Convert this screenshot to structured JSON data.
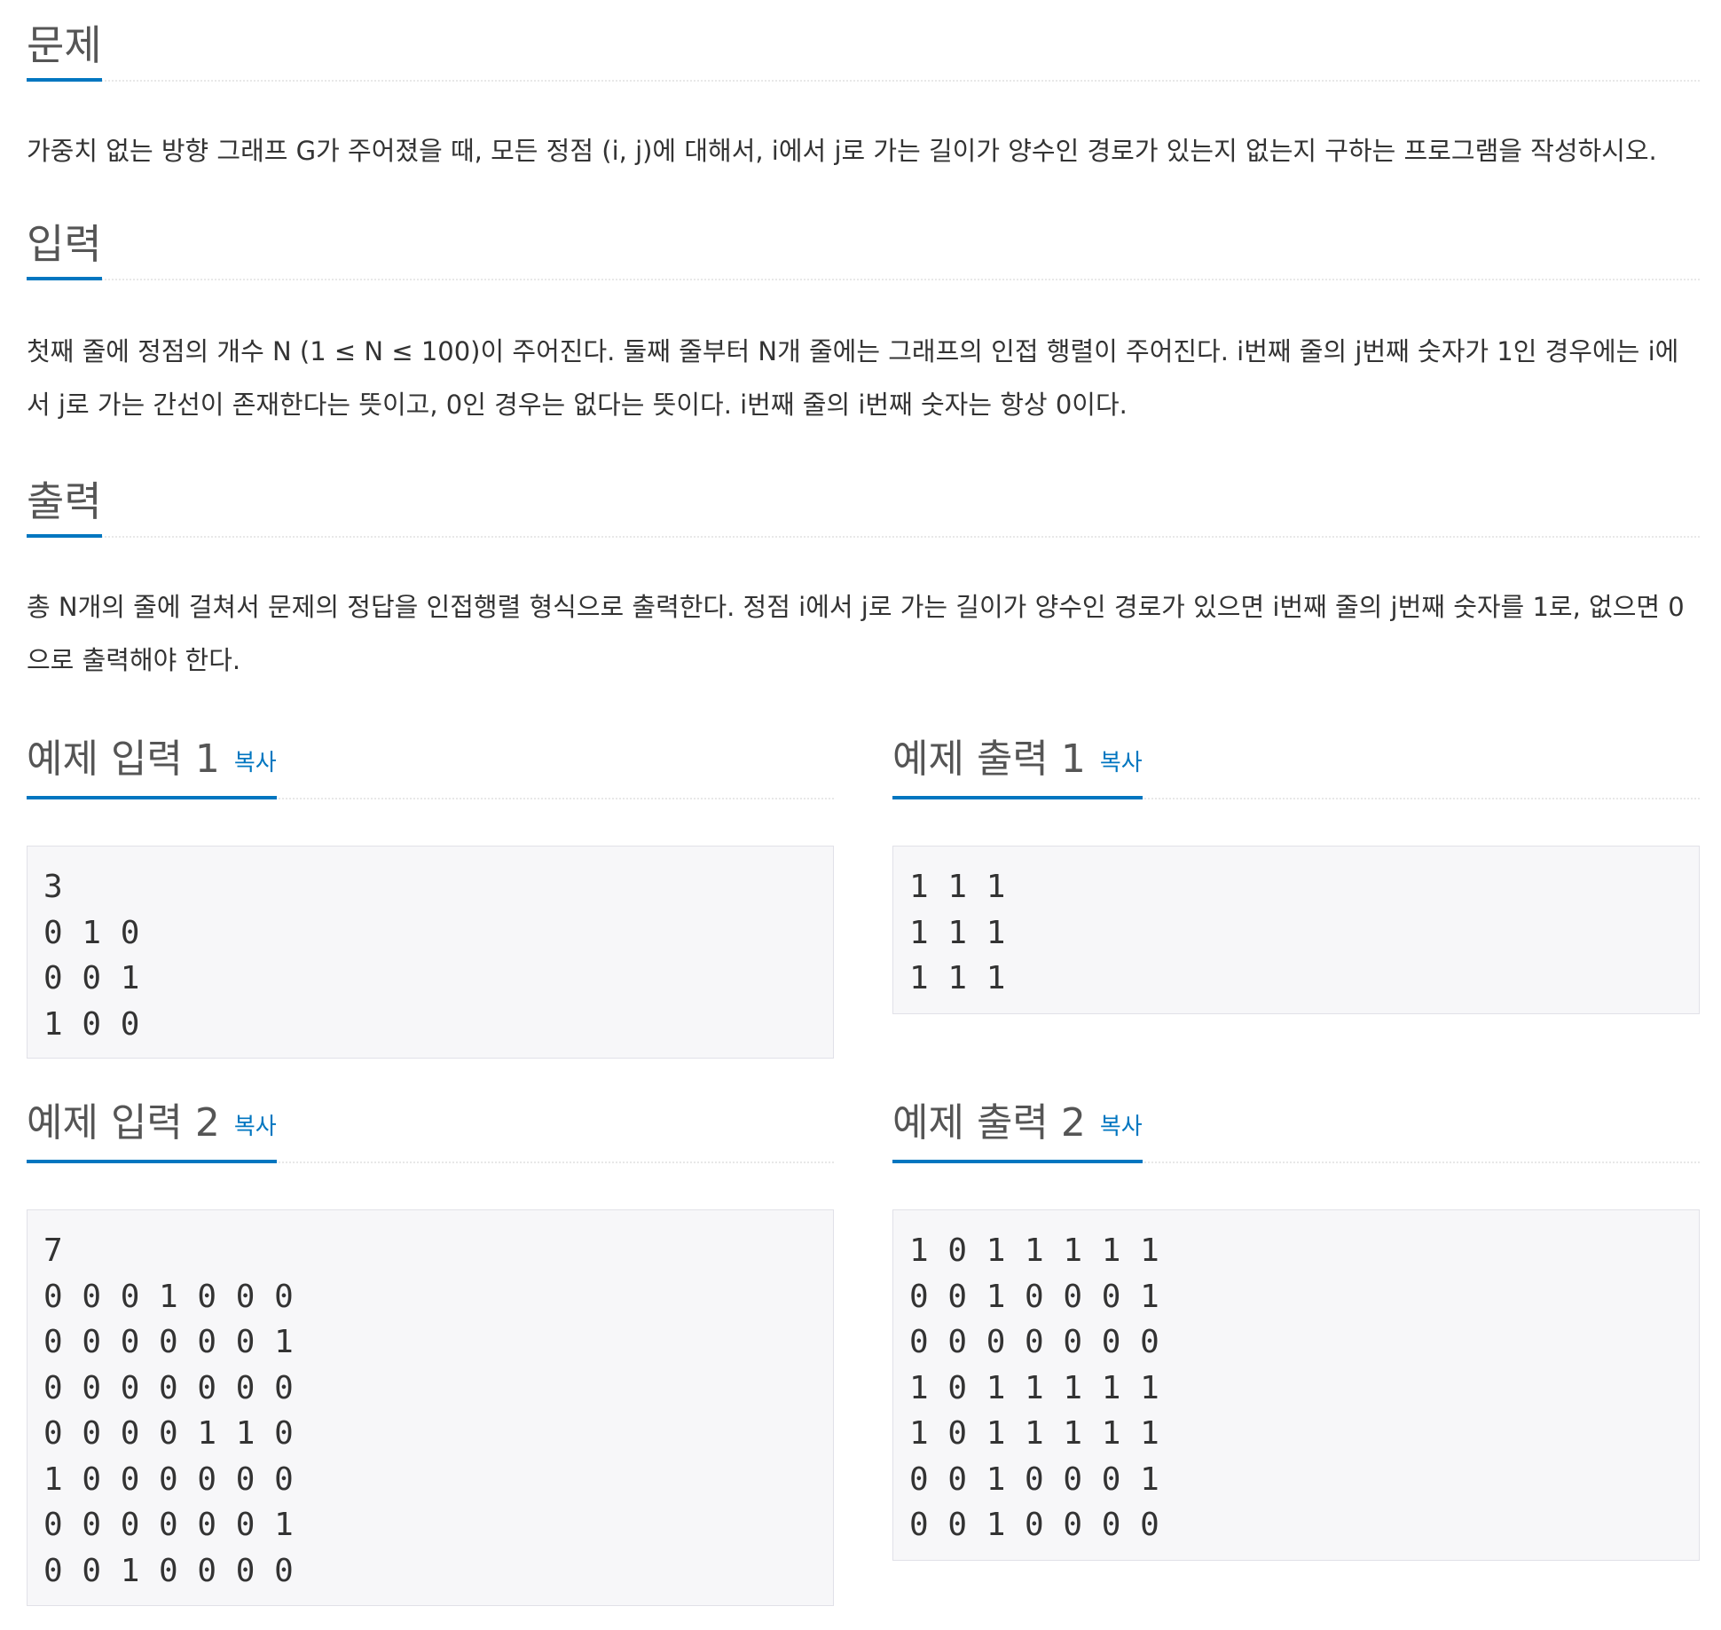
{
  "problem": {
    "title": "문제",
    "body": "가중치 없는 방향 그래프 G가 주어졌을 때, 모든 정점 (i, j)에 대해서, i에서 j로 가는 길이가 양수인 경로가 있는지 없는지 구하는 프로그램을 작성하시오."
  },
  "input": {
    "title": "입력",
    "body": "첫째 줄에 정점의 개수 N (1 ≤ N ≤ 100)이 주어진다. 둘째 줄부터 N개 줄에는 그래프의 인접 행렬이 주어진다. i번째 줄의 j번째 숫자가 1인 경우에는 i에서 j로 가는 간선이 존재한다는 뜻이고, 0인 경우는 없다는 뜻이다. i번째 줄의 i번째 숫자는 항상 0이다."
  },
  "output": {
    "title": "출력",
    "body": "총 N개의 줄에 걸쳐서 문제의 정답을 인접행렬 형식으로 출력한다. 정점 i에서 j로 가는 길이가 양수인 경로가 있으면 i번째 줄의 j번째 숫자를 1로, 없으면 0으로 출력해야 한다."
  },
  "copy_label": "복사",
  "samples": [
    {
      "input_title": "예제 입력 1",
      "input_text": "3\n0 1 0\n0 0 1\n1 0 0",
      "output_title": "예제 출력 1",
      "output_text": "1 1 1\n1 1 1\n1 1 1"
    },
    {
      "input_title": "예제 입력 2",
      "input_text": "7\n0 0 0 1 0 0 0\n0 0 0 0 0 0 1\n0 0 0 0 0 0 0\n0 0 0 0 1 1 0\n1 0 0 0 0 0 0\n0 0 0 0 0 0 1\n0 0 1 0 0 0 0",
      "output_title": "예제 출력 2",
      "output_text": "1 0 1 1 1 1 1\n0 0 1 0 0 0 1\n0 0 0 0 0 0 0\n1 0 1 1 1 1 1\n1 0 1 1 1 1 1\n0 0 1 0 0 0 1\n0 0 1 0 0 0 0"
    }
  ]
}
